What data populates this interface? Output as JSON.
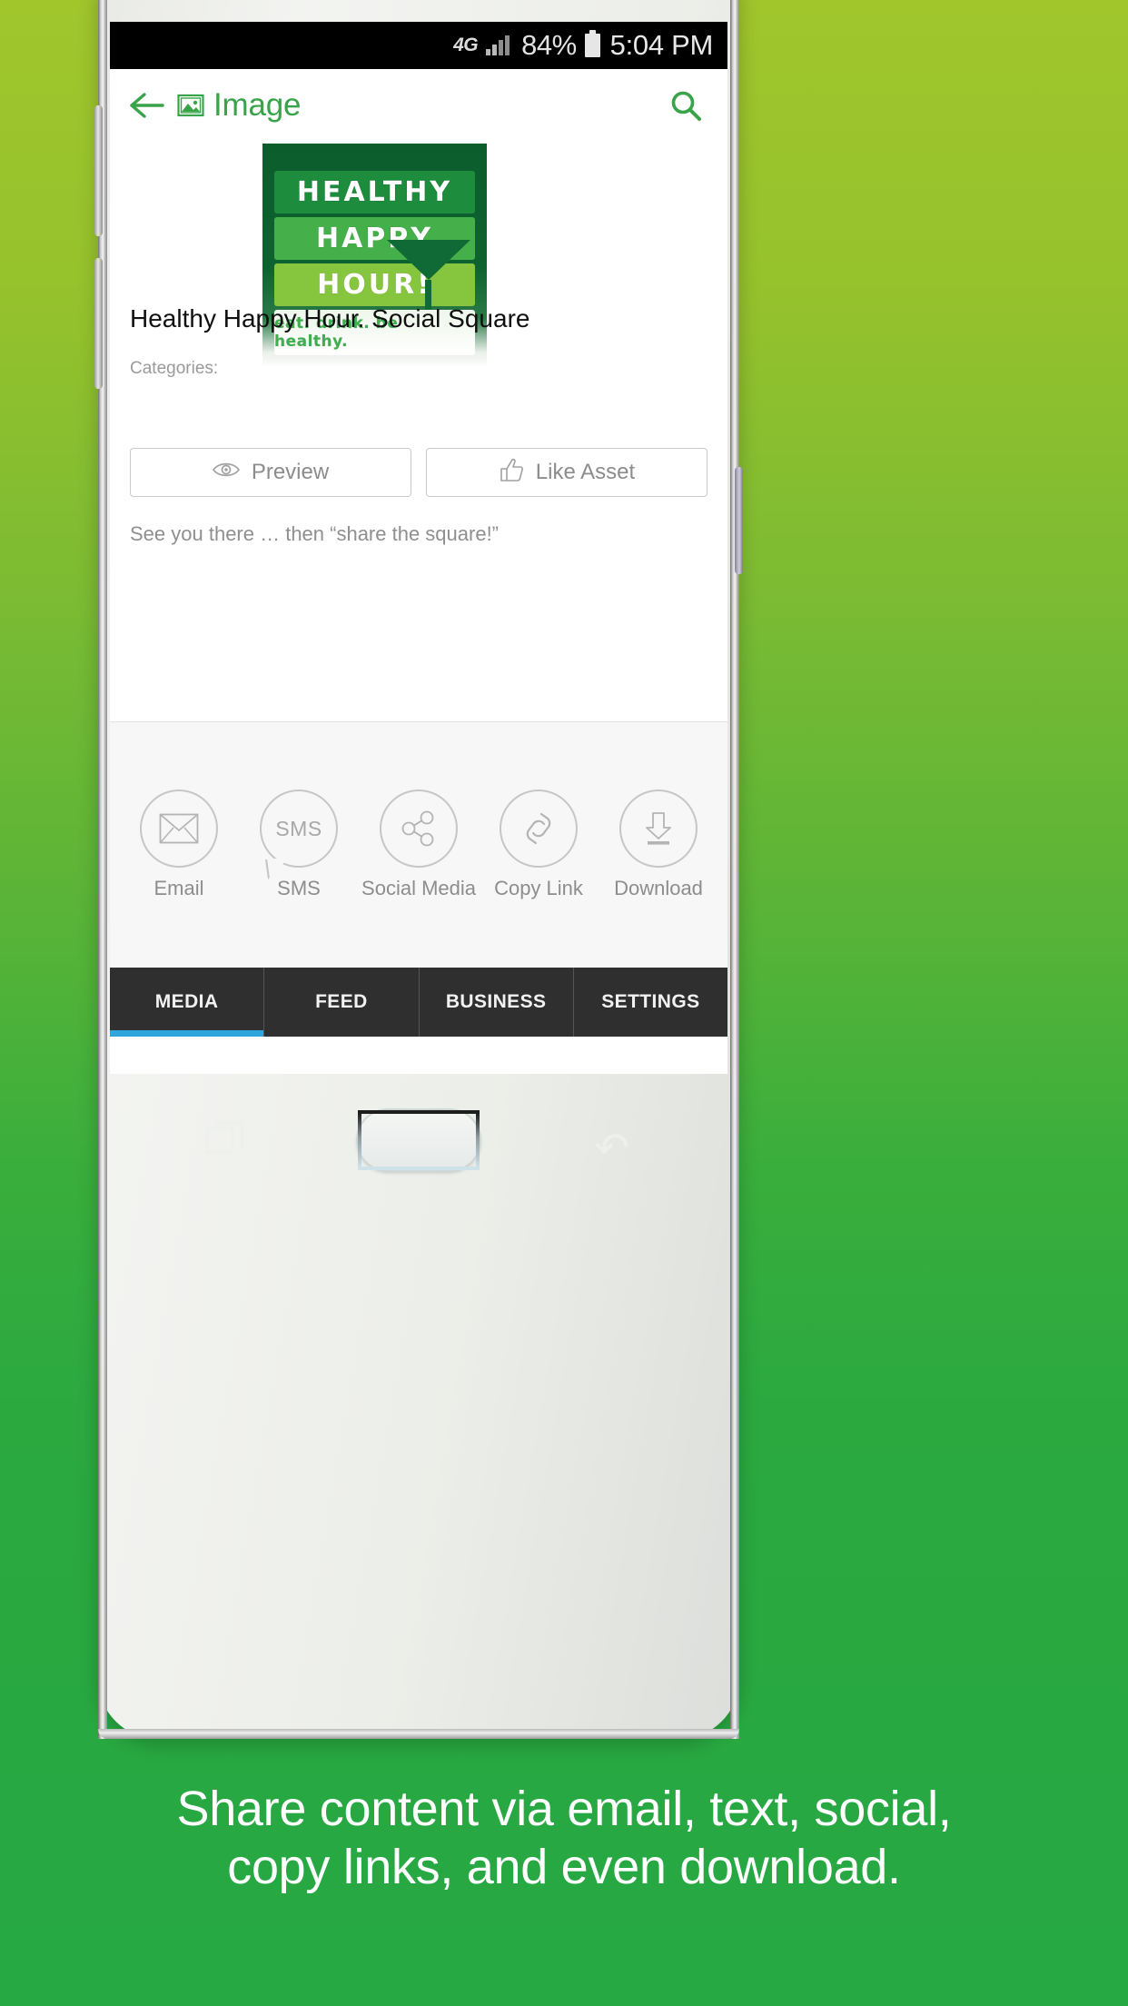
{
  "statusbar": {
    "network": "4G",
    "battery_pct": "84%",
    "clock": "5:04 PM",
    "signal_icon": "signal-bars-icon",
    "battery_icon": "battery-icon"
  },
  "appbar": {
    "back_icon": "back-arrow-icon",
    "image_icon": "image-icon",
    "title": "Image",
    "search_icon": "search-icon"
  },
  "asset": {
    "thumbnail": {
      "line1": "HEALTHY",
      "line2": "HAPPY",
      "line3": "HOUR!",
      "line4": "eat. drink. be healthy."
    },
    "title": "Healthy Happy Hour. Social Square",
    "categories_label": "Categories:",
    "description": "See you there … then “share the square!”"
  },
  "actions": [
    {
      "label": "Preview",
      "icon": "eye-icon"
    },
    {
      "label": "Like Asset",
      "icon": "thumbs-up-icon"
    }
  ],
  "share": [
    {
      "label": "Email",
      "icon": "envelope-icon"
    },
    {
      "label": "SMS",
      "icon": "sms-bubble-icon",
      "glyph": "SMS"
    },
    {
      "label": "Social Media",
      "icon": "share-nodes-icon"
    },
    {
      "label": "Copy Link",
      "icon": "chain-link-icon"
    },
    {
      "label": "Download",
      "icon": "download-arrow-icon"
    }
  ],
  "tabs": [
    {
      "label": "MEDIA",
      "active": true
    },
    {
      "label": "FEED",
      "active": false
    },
    {
      "label": "BUSINESS",
      "active": false
    },
    {
      "label": "SETTINGS",
      "active": false
    }
  ],
  "phone_nav": {
    "recent_icon": "recent-apps-icon",
    "home_button": "home-button",
    "back_icon": "android-back-icon"
  },
  "caption": {
    "line1": "Share content via email, text, social,",
    "line2": "copy links, and even download."
  },
  "colors": {
    "accent_green": "#39a34a",
    "tab_active": "#2fa5dd",
    "tabbar_bg": "#2f2f2f",
    "promo_bg_top": "#a0c62c",
    "promo_bg_bottom": "#26a843"
  }
}
